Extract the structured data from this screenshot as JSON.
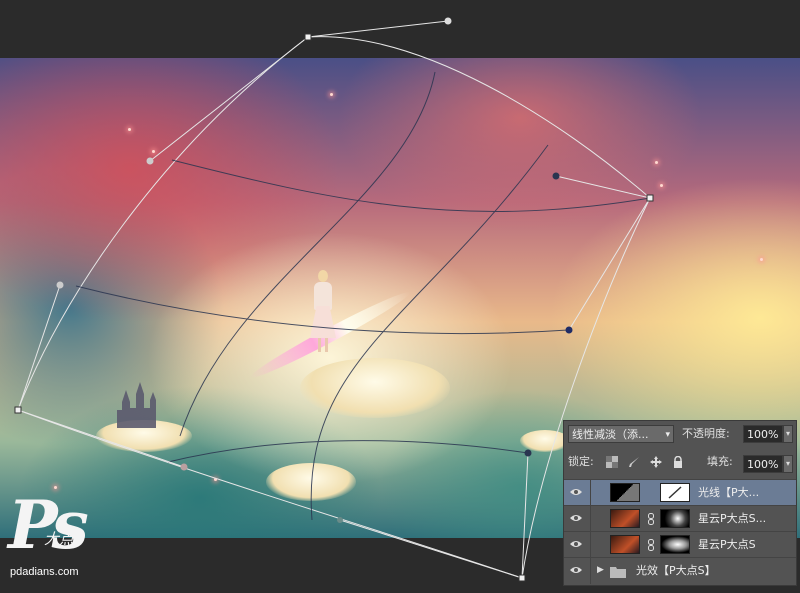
{
  "watermark": {
    "logo_text": "Ps",
    "logo_subtext": "大点",
    "site": "pdadians.com"
  },
  "layers_panel": {
    "blend_mode": "线性减淡（添...",
    "opacity_label": "不透明度:",
    "opacity_value": "100%",
    "lock_label": "锁定:",
    "fill_label": "填充:",
    "fill_value": "100%",
    "layers": [
      {
        "name": "光线【P大...",
        "selected": true,
        "has_mask": true
      },
      {
        "name": "星云P大点S...",
        "selected": false,
        "has_mask": true
      },
      {
        "name": "星云P大点S",
        "selected": false,
        "has_mask": true
      },
      {
        "name": "光效【P大点S】",
        "selected": false,
        "is_group": true
      }
    ]
  },
  "icons": [
    "eye-icon",
    "folder-icon",
    "chain-link-icon",
    "lock-transparent-icon",
    "lock-brush-icon",
    "lock-move-icon",
    "lock-all-icon",
    "dropdown-arrow-icon",
    "expand-triangle-icon"
  ],
  "colors": {
    "workspace_bg": "#2b2b2b",
    "panel_bg": "#535353",
    "selected_row": "#6b7c95",
    "handle_line": "#e6e6e6",
    "mesh_line": "#2a3550"
  }
}
